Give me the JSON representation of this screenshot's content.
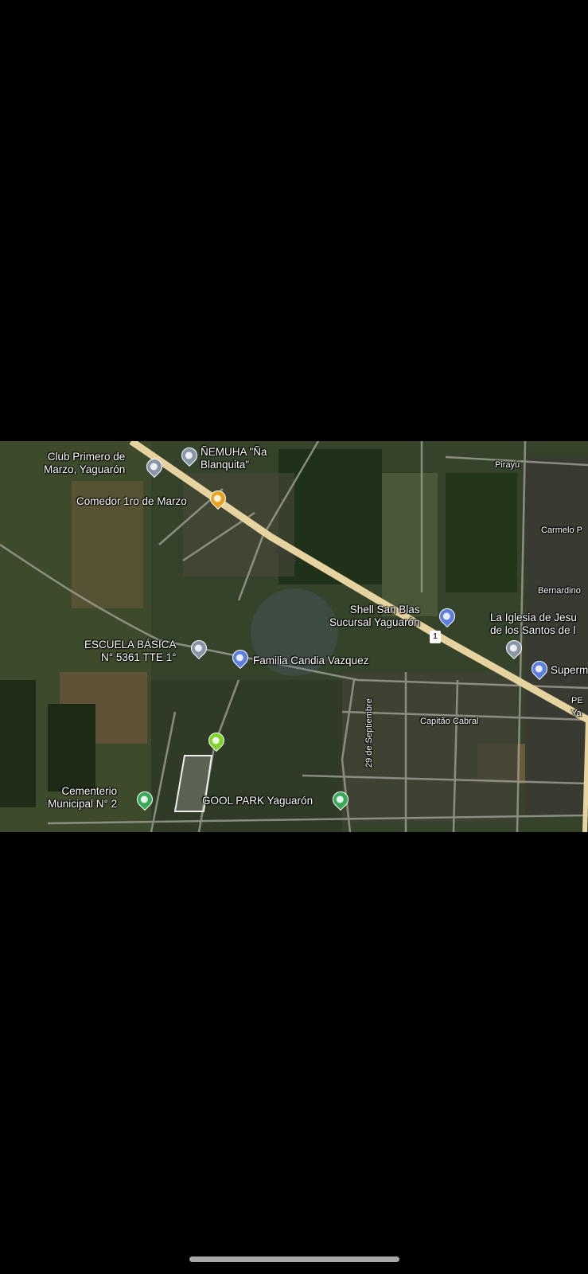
{
  "map": {
    "road_label": "PY01",
    "places": {
      "club": "Club Primero de\nMarzo, Yaguarón",
      "nemuha": "ÑEMUHA \"Ña\nBlanquita\"",
      "pirayu": "Pirayú",
      "comedor": "Comedor 1ro de Marzo",
      "carmelo": "Carmelo P",
      "bernardino": "Bernardino",
      "shell": "Shell San Blas\nSucursal Yaguarón",
      "iglesia": "La Iglesia de Jesu\nde los Santos de l",
      "escuela": "ESCUELA BÁSICA\nN° 5361 TTE 1°",
      "familia": "Familia Candia Vazquez",
      "super": "Superm",
      "pe": "PE\nYa",
      "septiembre": "29 de Septiembre",
      "capitao": "Capitão Cabral",
      "cementerio": "Cementerio\nMunicipal N° 2",
      "goolpark": "GOOL PARK Yaguarón"
    },
    "route_shield": "1",
    "colors": {
      "background": "#000000",
      "pin_orange": "#e8a21e",
      "pin_blue": "#5b7fe0",
      "pin_green": "#3aa85a",
      "pin_gray": "#8a96a8",
      "pin_lime": "#7fd42a",
      "highway": "#e6d3a0"
    }
  }
}
